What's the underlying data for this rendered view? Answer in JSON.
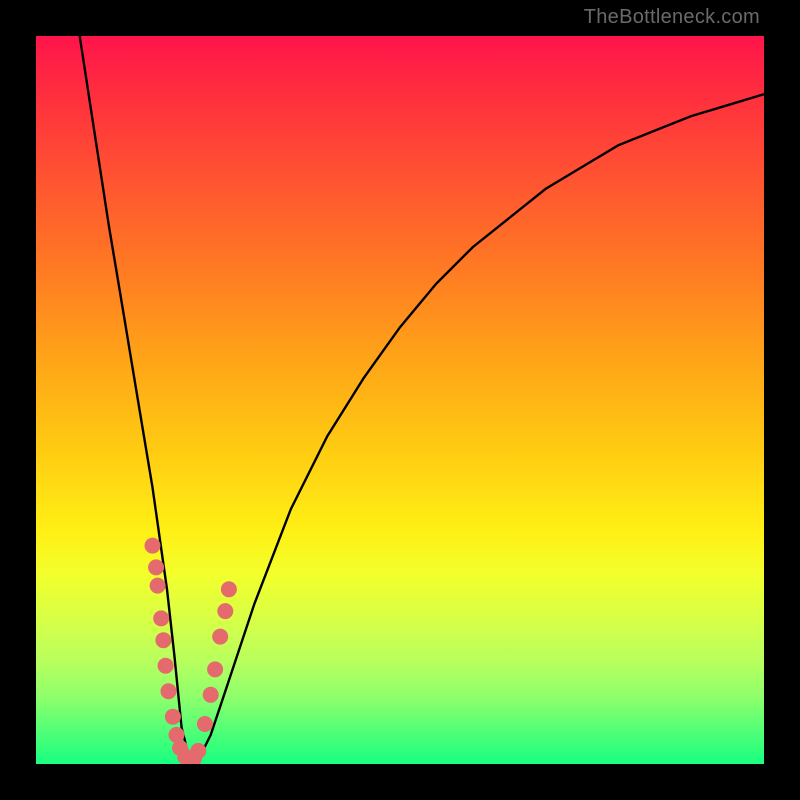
{
  "watermark": "TheBottleneck.com",
  "chart_data": {
    "type": "line",
    "title": "",
    "xlabel": "",
    "ylabel": "",
    "xlim": [
      0,
      100
    ],
    "ylim": [
      0,
      100
    ],
    "grid": false,
    "series": [
      {
        "name": "curve",
        "x": [
          6,
          8,
          10,
          12,
          14,
          16,
          18,
          19,
          20,
          21,
          22,
          24,
          26,
          30,
          35,
          40,
          45,
          50,
          55,
          60,
          65,
          70,
          75,
          80,
          85,
          90,
          95,
          100
        ],
        "values": [
          100,
          87,
          74,
          62,
          50,
          38,
          24,
          15,
          5,
          1,
          0,
          4,
          10,
          22,
          35,
          45,
          53,
          60,
          66,
          71,
          75,
          79,
          82,
          85,
          87,
          89,
          90.5,
          92
        ]
      }
    ],
    "markers": {
      "name": "data-points",
      "x": [
        16.0,
        16.5,
        16.7,
        17.2,
        17.5,
        17.8,
        18.2,
        18.8,
        19.3,
        19.8,
        20.5,
        21.2,
        21.7,
        22.3,
        23.2,
        24.0,
        24.6,
        25.3,
        26.0,
        26.5
      ],
      "y": [
        30.0,
        27.0,
        24.5,
        20.0,
        17.0,
        13.5,
        10.0,
        6.5,
        4.0,
        2.2,
        1.0,
        0.6,
        0.8,
        1.8,
        5.5,
        9.5,
        13.0,
        17.5,
        21.0,
        24.0
      ]
    },
    "gradient_stops": [
      {
        "pos": 0,
        "color": "#ff144b"
      },
      {
        "pos": 50,
        "color": "#ffc912"
      },
      {
        "pos": 75,
        "color": "#f2ff2c"
      },
      {
        "pos": 100,
        "color": "#19ff80"
      }
    ],
    "marker_color": "#e46a6d",
    "curve_color": "#000000"
  }
}
